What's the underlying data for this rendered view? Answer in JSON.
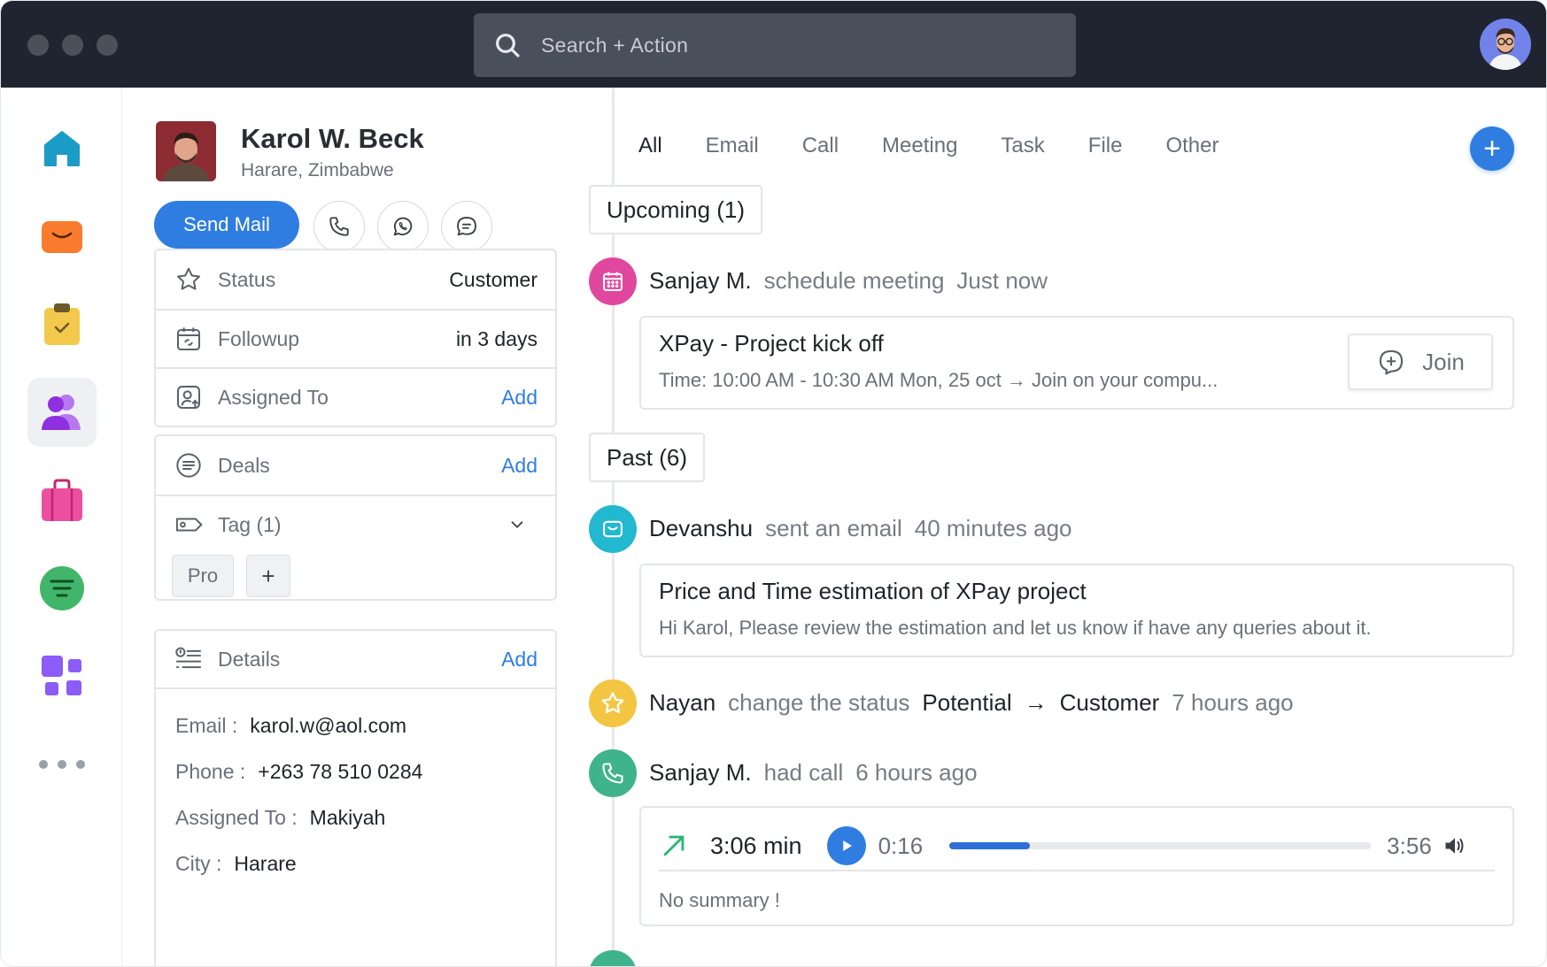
{
  "search": {
    "placeholder": "Search + Action"
  },
  "sidebar": {
    "items": [
      {
        "name": "home",
        "icon": "home-icon",
        "color": "#1a9cc6"
      },
      {
        "name": "inbox",
        "icon": "inbox-icon",
        "color": "#f97c2e"
      },
      {
        "name": "tasks",
        "icon": "clipboard-check-icon",
        "color": "#f2c94c"
      },
      {
        "name": "contacts",
        "icon": "users-icon",
        "color": "#a23fe6",
        "active": true
      },
      {
        "name": "deals",
        "icon": "briefcase-icon",
        "color": "#ec4fa0"
      },
      {
        "name": "reports",
        "icon": "filter-list-icon",
        "color": "#41b66a"
      },
      {
        "name": "apps",
        "icon": "apps-icon",
        "color": "#8b5cf6"
      },
      {
        "name": "more",
        "icon": "more-icon",
        "color": "#9aa0a8"
      }
    ]
  },
  "contact": {
    "name": "Karol W. Beck",
    "location": "Harare, Zimbabwe",
    "send_mail_label": "Send Mail"
  },
  "info": {
    "status_label": "Status",
    "status_value": "Customer",
    "followup_label": "Followup",
    "followup_value": "in 3 days",
    "assigned_label": "Assigned To",
    "assigned_action": "Add"
  },
  "deals": {
    "label": "Deals",
    "action": "Add",
    "tag_label": "Tag (1)",
    "tags": [
      "Pro"
    ],
    "add_tag": "+"
  },
  "details": {
    "label": "Details",
    "action": "Add",
    "email_key": "Email :",
    "email_val": "karol.w@aol.com",
    "phone_key": "Phone :",
    "phone_val": "+263 78 510 0284",
    "assigned_key": "Assigned To :",
    "assigned_val": "Makiyah",
    "city_key": "City :",
    "city_val": "Harare"
  },
  "tabs": [
    "All",
    "Email",
    "Call",
    "Meeting",
    "Task",
    "File",
    "Other"
  ],
  "add_button": "+",
  "upcoming": {
    "label": "Upcoming (1)",
    "event": {
      "who": "Sanjay M.",
      "action": "schedule meeting",
      "time": "Just now",
      "title": "XPay - Project kick off",
      "subtitle": "Time: 10:00 AM - 10:30 AM Mon, 25 oct → Join on your compu...",
      "join_label": "Join"
    }
  },
  "past": {
    "label": "Past (6)",
    "email_event": {
      "who": "Devanshu",
      "action": "sent an email",
      "time": "40 minutes ago",
      "title": "Price and Time estimation of XPay project",
      "body": "Hi Karol, Please review the estimation and let us know if have any queries about it."
    },
    "status_event": {
      "who": "Nayan",
      "action": "change the status",
      "from": "Potential",
      "arrow": "→",
      "to": "Customer",
      "time": "7 hours ago"
    },
    "call_event": {
      "who": "Sanjay M.",
      "action": "had call",
      "time": "6 hours ago",
      "duration": "3:06 min",
      "position": "0:16",
      "total": "3:56",
      "progress": 0.19,
      "summary": "No summary !"
    }
  },
  "colors": {
    "accent": "#2f7de1",
    "meeting": "#e0479e",
    "email": "#22b8cf",
    "status": "#f4c542",
    "call": "#3fb38c"
  }
}
